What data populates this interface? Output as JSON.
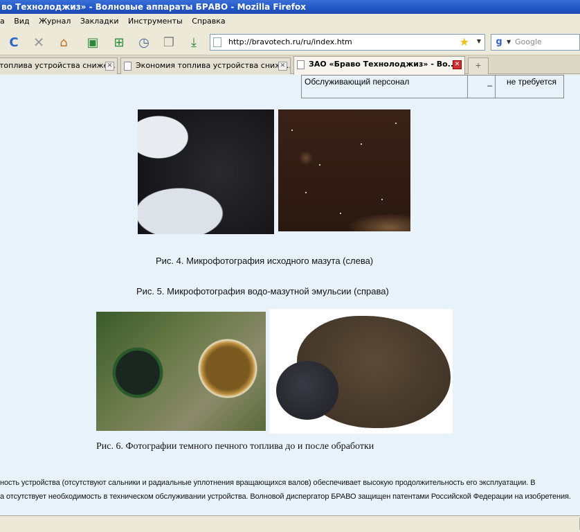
{
  "window": {
    "title": "во Технолоджиз» - Волновые аппараты БРАВО - Mozilla Firefox"
  },
  "menu": {
    "items": [
      "а",
      "Вид",
      "Журнал",
      "Закладки",
      "Инструменты",
      "Справка"
    ]
  },
  "navbar": {
    "url": "http://bravotech.ru/ru/index.htm",
    "search_placeholder": "Google",
    "icons": [
      "reload-icon",
      "stop-icon",
      "home-icon",
      "new-window-icon",
      "new-tab-icon",
      "history-icon",
      "copy-icon",
      "download-icon"
    ]
  },
  "tabs": [
    {
      "label": "топлива устройства сниже...",
      "active": false
    },
    {
      "label": "Экономия топлива устройства сниже...",
      "active": false
    },
    {
      "label": "ЗАО «Браво Технолоджиз» - Во...",
      "active": true
    }
  ],
  "table_fragment": {
    "label": "Обслуживающий персонал",
    "middle": "_",
    "value": "не требуется"
  },
  "captions": {
    "fig4": "Рис. 4. Микрофотография исходного мазута (слева)",
    "fig5": "Рис. 5. Микрофотография водо-мазутной эмульсии (справа)",
    "fig6": "Рис. 6. Фотографии темного печного топлива до и после обработки"
  },
  "body_text": {
    "line1": "ность устройства (отсутствуют сальники и радиальные уплотнения вращающихся валов) обеспечивает высокую продолжительность его эксплуатации. В",
    "line2": "а отсутствует необходимость в техническом обслуживании устройства. Волновой диспергатор БРАВО защищен патентами Российской Федерации на изобретения."
  }
}
